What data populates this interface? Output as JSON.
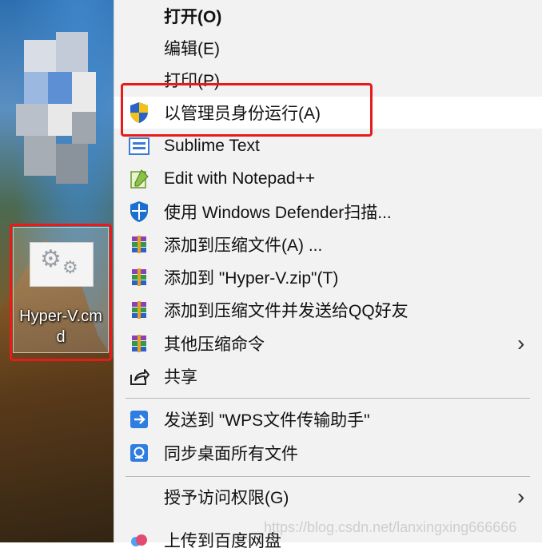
{
  "desktop": {
    "file_label_line1": "Hyper-V.cm",
    "file_label_line2": "d"
  },
  "menu": {
    "items": [
      {
        "label": "打开(O)",
        "icon": "none"
      },
      {
        "label": "编辑(E)",
        "icon": "none"
      },
      {
        "label": "打印(P)",
        "icon": "none"
      },
      {
        "label": "以管理员身份运行(A)",
        "icon": "uac-shield-icon"
      },
      {
        "label": "Sublime Text",
        "icon": "sublime-text-icon"
      },
      {
        "label": "Edit with Notepad++",
        "icon": "notepad-plus-plus-icon"
      },
      {
        "label": "使用 Windows Defender扫描...",
        "icon": "windows-defender-icon"
      },
      {
        "label": "添加到压缩文件(A) ...",
        "icon": "winrar-icon"
      },
      {
        "label": "添加到 \"Hyper-V.zip\"(T)",
        "icon": "winrar-icon"
      },
      {
        "label": "添加到压缩文件并发送给QQ好友",
        "icon": "winrar-icon"
      },
      {
        "label": "其他压缩命令",
        "icon": "winrar-icon"
      },
      {
        "label": "共享",
        "icon": "share-icon"
      },
      {
        "label": "发送到 \"WPS文件传输助手\"",
        "icon": "wps-send-icon"
      },
      {
        "label": "同步桌面所有文件",
        "icon": "sync-icon"
      },
      {
        "label": "授予访问权限(G)",
        "icon": "none"
      },
      {
        "label": "上传到百度网盘",
        "icon": "baidu-netdisk-icon"
      }
    ]
  },
  "watermark": "https://blog.csdn.net/lanxingxing666666",
  "colors": {
    "highlight_border": "#e81b1b",
    "menu_background": "#f2f2f2",
    "hover_background": "#ffffff"
  }
}
